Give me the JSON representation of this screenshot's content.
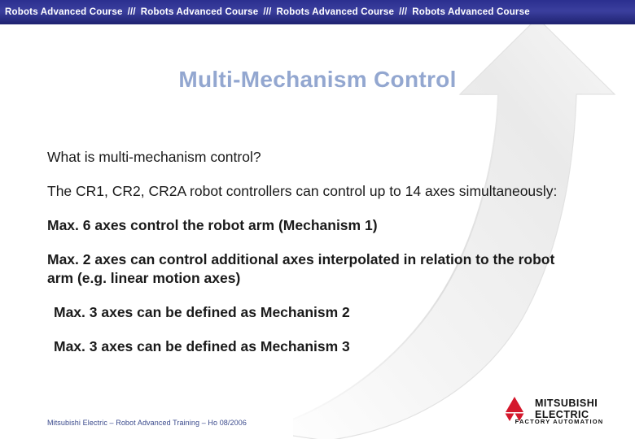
{
  "banner": {
    "item": "Robots Advanced Course",
    "separator": "///",
    "repeat": 4
  },
  "title": "Multi-Mechanism Control",
  "body": {
    "paragraphs": [
      {
        "text": "What is multi-mechanism control?",
        "bold": false
      },
      {
        "text": "The CR1, CR2, CR2A robot controllers can control up to 14 axes simultaneously:",
        "bold": false
      },
      {
        "text": "Max. 6 axes control the robot arm (Mechanism 1)",
        "bold": true
      },
      {
        "text": "Max. 2 axes can control additional axes interpolated in relation to the robot arm (e.g. linear motion axes)",
        "bold": true
      },
      {
        "text": "Max. 3 axes can be defined as Mechanism 2",
        "bold": true
      },
      {
        "text": "Max. 3 axes can be defined as Mechanism 3",
        "bold": true
      }
    ]
  },
  "footer": "Mitsubishi Electric – Robot Advanced Training – Ho 08/2006",
  "logo": {
    "line1": "MITSUBISHI",
    "line2": "ELECTRIC",
    "tagline": "FACTORY AUTOMATION"
  },
  "colors": {
    "banner_bg": "#2b2f8f",
    "title": "#93a7d0",
    "footer": "#3a4a8c",
    "logo_mark": "#d4182c",
    "arrow_fill": "#f2f2f2"
  }
}
